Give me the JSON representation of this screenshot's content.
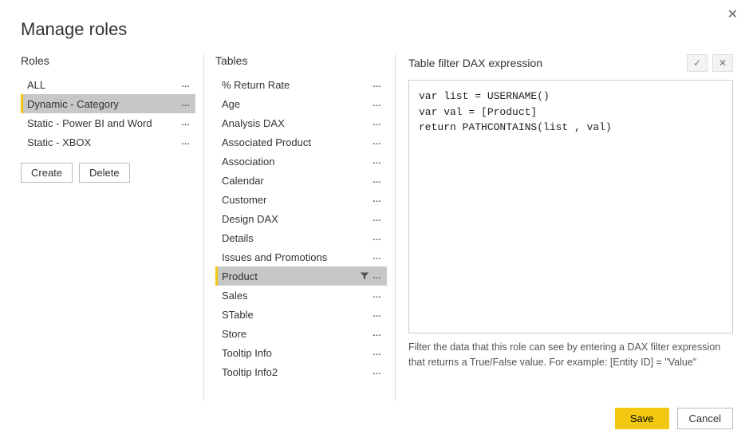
{
  "dialog": {
    "title": "Manage roles",
    "close_glyph": "✕"
  },
  "roles": {
    "header": "Roles",
    "items": [
      {
        "label": "ALL",
        "selected": false
      },
      {
        "label": "Dynamic - Category",
        "selected": true
      },
      {
        "label": "Static - Power BI and Word",
        "selected": false
      },
      {
        "label": "Static - XBOX",
        "selected": false
      }
    ],
    "create_label": "Create",
    "delete_label": "Delete"
  },
  "tables": {
    "header": "Tables",
    "items": [
      {
        "label": "% Return Rate",
        "selected": false,
        "has_filter": false
      },
      {
        "label": "Age",
        "selected": false,
        "has_filter": false
      },
      {
        "label": "Analysis DAX",
        "selected": false,
        "has_filter": false
      },
      {
        "label": "Associated Product",
        "selected": false,
        "has_filter": false
      },
      {
        "label": "Association",
        "selected": false,
        "has_filter": false
      },
      {
        "label": "Calendar",
        "selected": false,
        "has_filter": false
      },
      {
        "label": "Customer",
        "selected": false,
        "has_filter": false
      },
      {
        "label": "Design DAX",
        "selected": false,
        "has_filter": false
      },
      {
        "label": "Details",
        "selected": false,
        "has_filter": false
      },
      {
        "label": "Issues and Promotions",
        "selected": false,
        "has_filter": false
      },
      {
        "label": "Product",
        "selected": true,
        "has_filter": true
      },
      {
        "label": "Sales",
        "selected": false,
        "has_filter": false
      },
      {
        "label": "STable",
        "selected": false,
        "has_filter": false
      },
      {
        "label": "Store",
        "selected": false,
        "has_filter": false
      },
      {
        "label": "Tooltip Info",
        "selected": false,
        "has_filter": false
      },
      {
        "label": "Tooltip Info2",
        "selected": false,
        "has_filter": false
      }
    ]
  },
  "expression": {
    "header": "Table filter DAX expression",
    "accept_glyph": "✓",
    "discard_glyph": "✕",
    "code": "var list = USERNAME()\nvar val = [Product]\nreturn PATHCONTAINS(list , val)",
    "help": "Filter the data that this role can see by entering a DAX filter expression that returns a True/False value. For example: [Entity ID] = \"Value\""
  },
  "footer": {
    "save_label": "Save",
    "cancel_label": "Cancel"
  }
}
